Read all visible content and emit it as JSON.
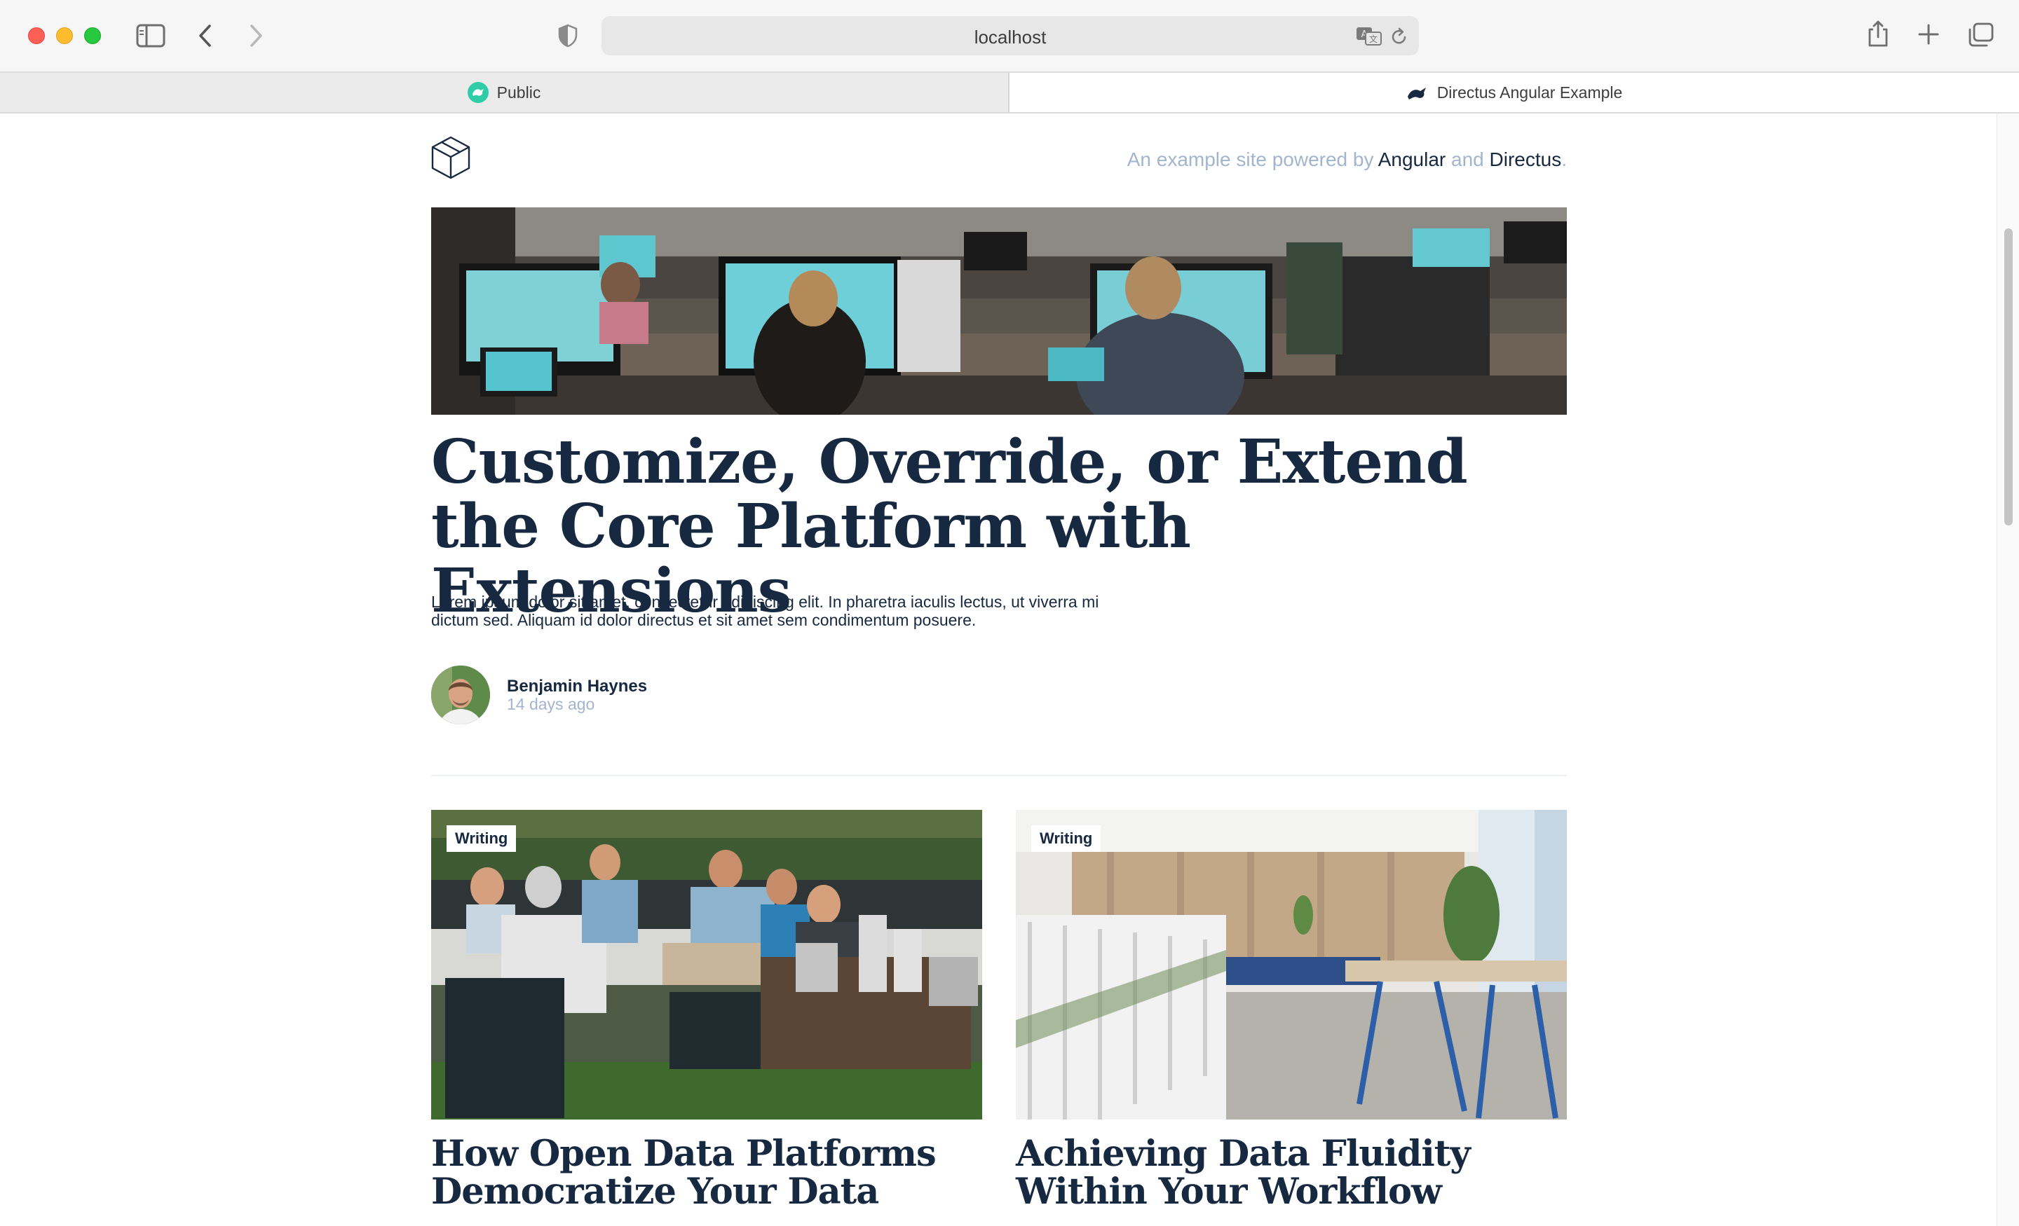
{
  "browser": {
    "url": "localhost",
    "tabs": [
      {
        "label": "Public",
        "active": false
      },
      {
        "label": "Directus Angular Example",
        "active": true
      }
    ]
  },
  "header": {
    "tagline_prefix": "An example site powered by",
    "tagline_angular": "Angular",
    "tagline_and": "and",
    "tagline_directus": "Directus",
    "tagline_period": "."
  },
  "hero": {
    "title": "Customize, Override, or Extend the Core Platform with Extensions",
    "excerpt": "Lorem ipsum dolor sit amet, consectetur adipiscing elit. In pharetra iaculis lectus, ut viverra mi dictum sed. Aliquam id dolor directus et sit amet sem condimentum posuere.",
    "author": "Benjamin Haynes",
    "date": "14 days ago"
  },
  "articles": [
    {
      "category": "Writing",
      "title": "How Open Data Platforms Democratize Your Data"
    },
    {
      "category": "Writing",
      "title": "Achieving Data Fluidity Within Your Workflow"
    }
  ],
  "colors": {
    "text_dark": "#172940",
    "muted": "#a2b5cd",
    "directus_green": "#2ecda7"
  }
}
